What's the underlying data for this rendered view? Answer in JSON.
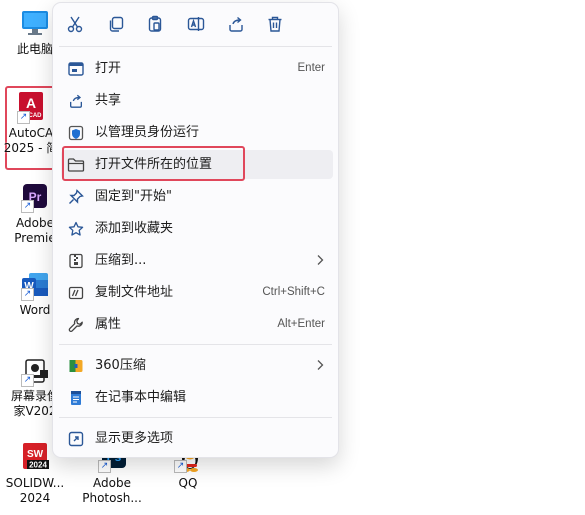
{
  "desktop": {
    "icons": [
      {
        "name": "this-pc",
        "label": "此电脑"
      },
      {
        "name": "autocad",
        "label": "AutoCA\n2025 - 简",
        "badge": "A",
        "badge_text": "CAD"
      },
      {
        "name": "premiere",
        "label": "Adobe\nPremie",
        "badge": "Pr"
      },
      {
        "name": "word",
        "label": "Word",
        "badge": "W"
      },
      {
        "name": "screen-recorder",
        "label": "屏幕录像\n家V202"
      },
      {
        "name": "solidworks",
        "label": "SOLIDW...\n2024",
        "badge": "SW",
        "badge_text": "2024"
      },
      {
        "name": "photoshop",
        "label": "Adobe\nPhotosh...",
        "badge": "Ps"
      },
      {
        "name": "qq",
        "label": "QQ"
      }
    ]
  },
  "toolbar": {
    "cut": "cut-icon",
    "copy": "copy-icon",
    "paste": "paste-icon",
    "rename": "rename-icon",
    "share": "share-icon",
    "delete": "delete-icon"
  },
  "menu": {
    "items": [
      {
        "label": "打开",
        "shortcut": "Enter"
      },
      {
        "label": "共享"
      },
      {
        "label": "以管理员身份运行"
      },
      {
        "label": "打开文件所在的位置"
      },
      {
        "label": "固定到\"开始\""
      },
      {
        "label": "添加到收藏夹"
      },
      {
        "label": "压缩到..."
      },
      {
        "label": "复制文件地址",
        "shortcut": "Ctrl+Shift+C"
      },
      {
        "label": "属性",
        "shortcut": "Alt+Enter"
      },
      {
        "label": "360压缩"
      },
      {
        "label": "在记事本中编辑"
      },
      {
        "label": "显示更多选项"
      }
    ]
  },
  "colors": {
    "highlight_border": "#e0475b",
    "autocad": "#c8102e",
    "premiere": "#1f0a3c",
    "word": "#185abd",
    "solidworks": "#d62027",
    "photoshop": "#001e36"
  }
}
